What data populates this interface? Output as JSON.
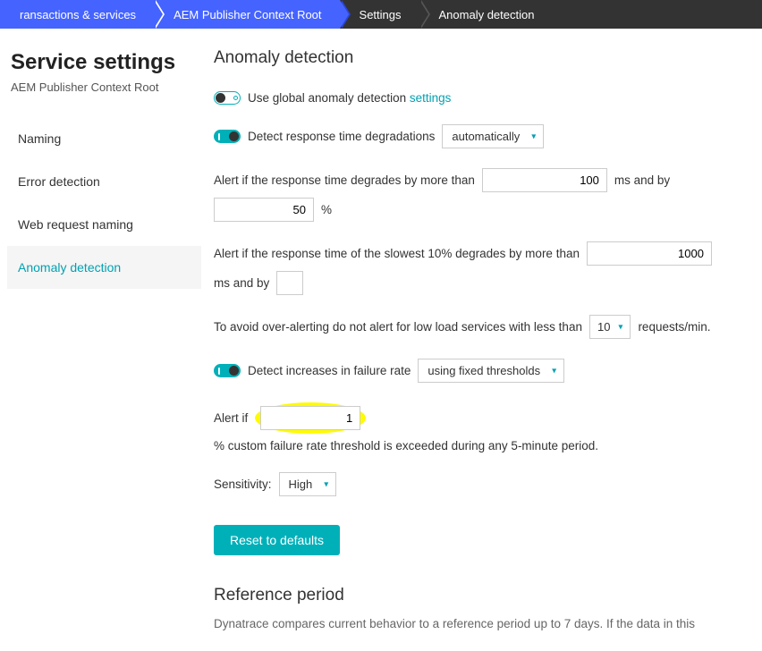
{
  "breadcrumb": {
    "items": [
      "ransactions & services",
      "AEM Publisher Context Root",
      "Settings",
      "Anomaly detection"
    ]
  },
  "sidebar": {
    "title": "Service settings",
    "subtitle": "AEM Publisher Context Root",
    "items": [
      {
        "label": "Naming"
      },
      {
        "label": "Error detection"
      },
      {
        "label": "Web request naming"
      },
      {
        "label": "Anomaly detection",
        "active": true
      }
    ]
  },
  "main": {
    "heading": "Anomaly detection",
    "global": {
      "text_prefix": "Use global anomaly detection ",
      "link": "settings"
    },
    "detect_rt": {
      "label": "Detect response time degradations",
      "mode": "automatically"
    },
    "alert_rt": {
      "text1": "Alert if the response time degrades by more than",
      "val_ms": "100",
      "unit1": "ms and by",
      "val_pct": "50",
      "unit2": "%"
    },
    "alert_slow": {
      "text1": "Alert if the response time of the slowest 10% degrades by more than",
      "val_ms": "1000",
      "unit1": "ms and by"
    },
    "low_load": {
      "text1": "To avoid over-alerting do not alert for low load services with less than",
      "val": "10",
      "unit": "requests/min."
    },
    "detect_fail": {
      "label": "Detect increases in failure rate",
      "mode": "using fixed thresholds"
    },
    "alert_fail": {
      "text1": "Alert if",
      "val": "1",
      "text2": "% custom failure rate threshold is exceeded during any 5-minute period."
    },
    "sensitivity": {
      "label": "Sensitivity:",
      "value": "High"
    },
    "reset_label": "Reset to defaults",
    "ref": {
      "heading": "Reference period",
      "body": "Dynatrace compares current behavior to a reference period up to 7 days. If the data in this"
    }
  }
}
